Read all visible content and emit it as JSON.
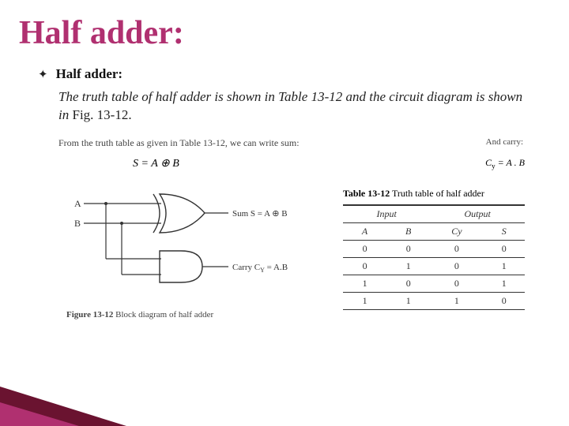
{
  "title": "Half adder:",
  "bullet_heading": "Half adder:",
  "body": "The truth table of half adder is shown in Table 13-12 and the circuit diagram is shown in ",
  "body_tail": "Fig. 13-12.",
  "intro_left": "From the truth table as given in Table 13-12, we can write sum:",
  "intro_right": "And carry:",
  "eq_sum": "S = A ⊕ B",
  "eq_carry_prefix": "C",
  "eq_carry_sub": "y",
  "eq_carry_tail": " = A . B",
  "circuit": {
    "input_a": "A",
    "input_b": "B",
    "sum_label": "Sum S = A ⊕ B",
    "carry_label_prefix": "Carry C",
    "carry_label_sub": "Y",
    "carry_label_tail": " = A.B",
    "caption_strong": "Figure 13-12",
    "caption_text": "  Block diagram of half adder"
  },
  "table": {
    "caption_strong": "Table 13-12",
    "caption_text": "  Truth table of half adder",
    "group_input": "Input",
    "group_output": "Output",
    "col_a": "A",
    "col_b": "B",
    "col_cy": "Cy",
    "col_s": "S"
  },
  "chart_data": {
    "type": "table",
    "title": "Table 13-12 Truth table of half adder",
    "columns": [
      "A",
      "B",
      "Cy",
      "S"
    ],
    "rows": [
      [
        0,
        0,
        0,
        0
      ],
      [
        0,
        1,
        0,
        1
      ],
      [
        1,
        0,
        0,
        1
      ],
      [
        1,
        1,
        1,
        0
      ]
    ]
  }
}
